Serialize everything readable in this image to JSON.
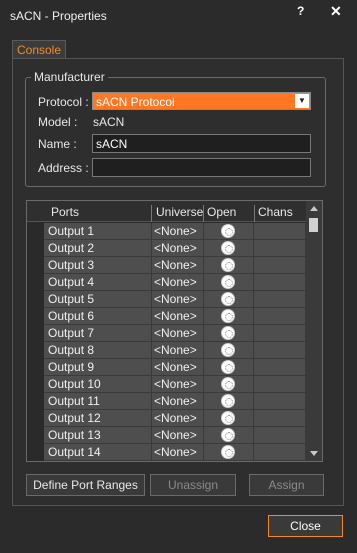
{
  "window": {
    "title": "sACN - Properties",
    "help": "?",
    "close": "✕"
  },
  "tab": {
    "label": "Console"
  },
  "manufacturer": {
    "legend": "Manufacturer",
    "protocol_label": "Protocol :",
    "protocol_value": "sACN Protocol",
    "model_label": "Model :",
    "model_value": "sACN",
    "name_label": "Name :",
    "name_value": "sACN",
    "address_label": "Address :",
    "address_value": ""
  },
  "grid": {
    "headers": {
      "ports": "Ports",
      "universe": "Universe",
      "open": "Open",
      "chans": "Chans"
    },
    "rows": [
      {
        "port": "Output 1",
        "universe": "<None>",
        "chans": ""
      },
      {
        "port": "Output 2",
        "universe": "<None>",
        "chans": ""
      },
      {
        "port": "Output 3",
        "universe": "<None>",
        "chans": ""
      },
      {
        "port": "Output 4",
        "universe": "<None>",
        "chans": ""
      },
      {
        "port": "Output 5",
        "universe": "<None>",
        "chans": ""
      },
      {
        "port": "Output 6",
        "universe": "<None>",
        "chans": ""
      },
      {
        "port": "Output 7",
        "universe": "<None>",
        "chans": ""
      },
      {
        "port": "Output 8",
        "universe": "<None>",
        "chans": ""
      },
      {
        "port": "Output 9",
        "universe": "<None>",
        "chans": ""
      },
      {
        "port": "Output 10",
        "universe": "<None>",
        "chans": ""
      },
      {
        "port": "Output 11",
        "universe": "<None>",
        "chans": ""
      },
      {
        "port": "Output 12",
        "universe": "<None>",
        "chans": ""
      },
      {
        "port": "Output 13",
        "universe": "<None>",
        "chans": ""
      },
      {
        "port": "Output 14",
        "universe": "<None>",
        "chans": ""
      }
    ]
  },
  "buttons": {
    "define_port_ranges": "Define Port Ranges",
    "unassign": "Unassign",
    "assign": "Assign",
    "close": "Close"
  },
  "colors": {
    "accent": "#ff7722",
    "tab_text": "#f08a24"
  },
  "icons": {
    "open_cell": "knob-icon",
    "dropdown": "chevron-down-icon"
  }
}
